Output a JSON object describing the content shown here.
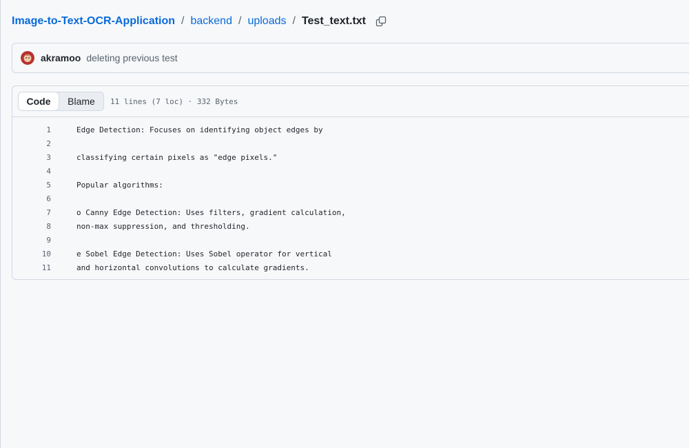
{
  "breadcrumb": {
    "repo": "Image-to-Text-OCR-Application",
    "separator": "/",
    "folders": [
      "backend",
      "uploads"
    ],
    "file": "Test_text.txt"
  },
  "commit": {
    "author": "akramoo",
    "message": "deleting previous test"
  },
  "file_view": {
    "tabs": [
      "Code",
      "Blame"
    ],
    "selected_tab": "Code",
    "meta": "11 lines (7 loc) · 332 Bytes",
    "lines": [
      {
        "num": "1",
        "text": "Edge Detection: Focuses on identifying object edges by"
      },
      {
        "num": "2",
        "text": ""
      },
      {
        "num": "3",
        "text": "classifying certain pixels as \"edge pixels.\""
      },
      {
        "num": "4",
        "text": ""
      },
      {
        "num": "5",
        "text": "Popular algorithms:"
      },
      {
        "num": "6",
        "text": ""
      },
      {
        "num": "7",
        "text": "o Canny Edge Detection: Uses filters, gradient calculation,"
      },
      {
        "num": "8",
        "text": "non-max suppression, and thresholding."
      },
      {
        "num": "9",
        "text": ""
      },
      {
        "num": "10",
        "text": "e Sobel Edge Detection: Uses Sobel operator for vertical"
      },
      {
        "num": "11",
        "text": "and horizontal convolutions to calculate gradients."
      }
    ]
  },
  "icons": {
    "copy": "copy-icon",
    "avatar": "avatar"
  },
  "colors": {
    "link": "#0969da",
    "muted": "#59636e",
    "border": "#d1d9e0",
    "background": "#f6f8fa"
  }
}
